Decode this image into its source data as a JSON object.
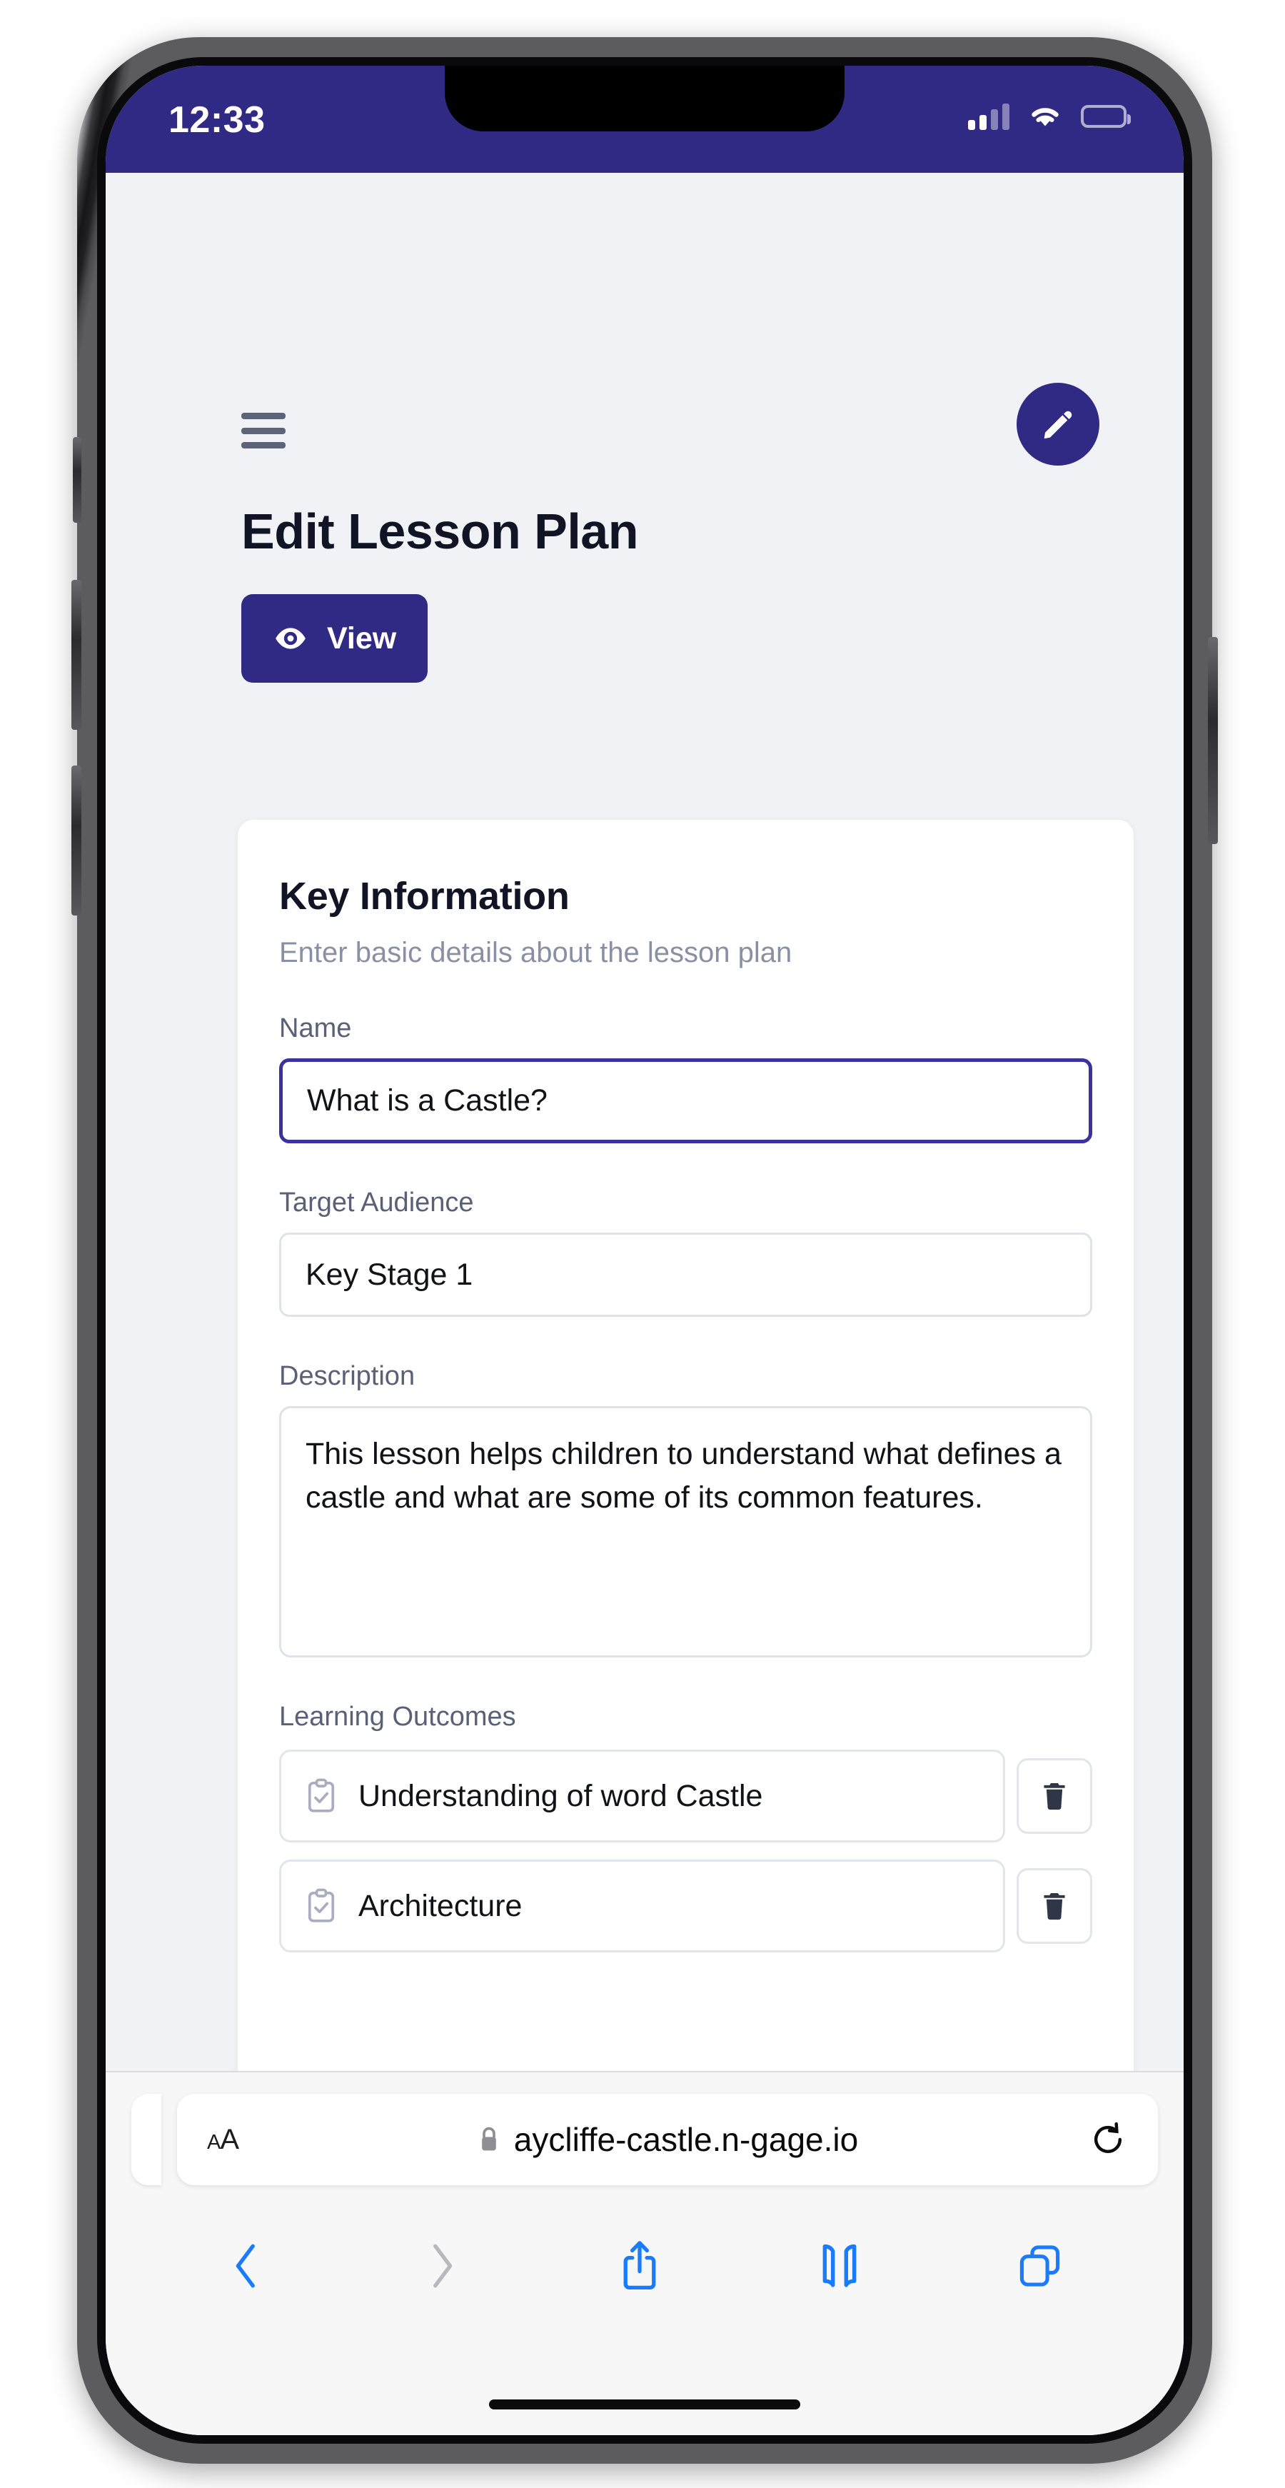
{
  "status_bar": {
    "time": "12:33",
    "cellular_icon": "cellular-signal-icon",
    "wifi_icon": "wifi-icon",
    "battery_icon": "battery-icon",
    "background_color": "#312a85"
  },
  "app": {
    "menu_icon": "hamburger-menu-icon",
    "edit_fab_icon": "pencil-icon",
    "title": "Edit Lesson Plan",
    "view_button": {
      "label": "View",
      "icon": "eye-icon"
    },
    "accent_color": "#312a85",
    "card": {
      "title": "Key Information",
      "subtitle": "Enter basic details about the lesson plan",
      "fields": [
        {
          "label": "Name",
          "value": "What is a Castle?",
          "focused": true
        },
        {
          "label": "Target Audience",
          "value": "Key Stage 1",
          "focused": false
        },
        {
          "label": "Description",
          "value": "This lesson helps children to understand what defines a castle and what are some of its common features.",
          "focused": false
        }
      ],
      "learning_outcomes": {
        "label": "Learning Outcomes",
        "item_icon": "clipboard-check-icon",
        "delete_icon": "trash-icon",
        "items": [
          {
            "text": "Understanding of word Castle"
          },
          {
            "text": "Architecture"
          }
        ]
      }
    }
  },
  "safari": {
    "aa_button_label": "AA",
    "lock_icon": "lock-icon",
    "url": "aycliffe-castle.n-gage.io",
    "reload_icon": "reload-icon",
    "toolbar": [
      {
        "name": "back-button",
        "icon": "chevron-left-icon",
        "enabled": true
      },
      {
        "name": "forward-button",
        "icon": "chevron-right-icon",
        "enabled": false
      },
      {
        "name": "share-button",
        "icon": "share-icon",
        "enabled": true
      },
      {
        "name": "bookmarks-button",
        "icon": "book-icon",
        "enabled": true
      },
      {
        "name": "tabs-button",
        "icon": "tabs-icon",
        "enabled": true
      }
    ],
    "active_color": "#1a7bfb",
    "disabled_color": "#b8b8bd"
  }
}
